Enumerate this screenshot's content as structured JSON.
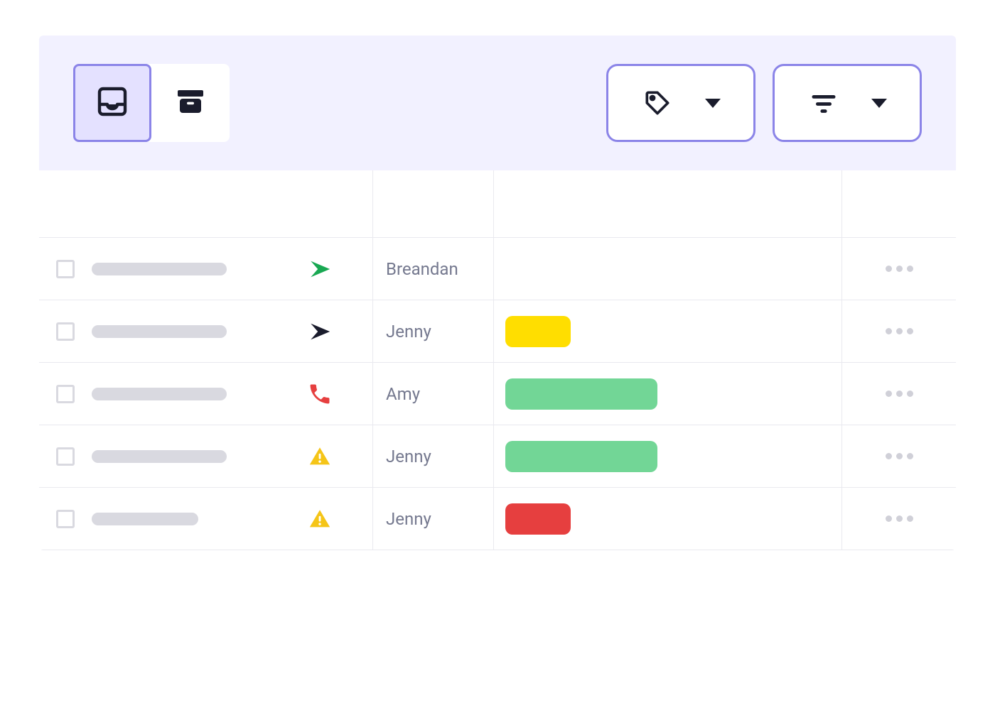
{
  "colors": {
    "green": "#18a852",
    "dark": "#1a1c2c",
    "red": "#e63f3f",
    "yellow": "#f5c518",
    "pill_yellow": "#ffde00",
    "pill_green": "#72d696",
    "pill_red": "#e63f3f"
  },
  "rows": [
    {
      "type_icon": "send",
      "type_color_key": "green",
      "person": "Breandan",
      "status_color_key": null,
      "status_width": 0,
      "name_width": 190
    },
    {
      "type_icon": "send",
      "type_color_key": "dark",
      "person": "Jenny",
      "status_color_key": "pill_yellow",
      "status_width": 92,
      "name_width": 190
    },
    {
      "type_icon": "phone",
      "type_color_key": "red",
      "person": "Amy",
      "status_color_key": "pill_green",
      "status_width": 214,
      "name_width": 190
    },
    {
      "type_icon": "alert",
      "type_color_key": "yellow",
      "person": "Jenny",
      "status_color_key": "pill_green",
      "status_width": 214,
      "name_width": 190
    },
    {
      "type_icon": "alert",
      "type_color_key": "yellow",
      "person": "Jenny",
      "status_color_key": "pill_red",
      "status_width": 92,
      "name_width": 150
    }
  ]
}
